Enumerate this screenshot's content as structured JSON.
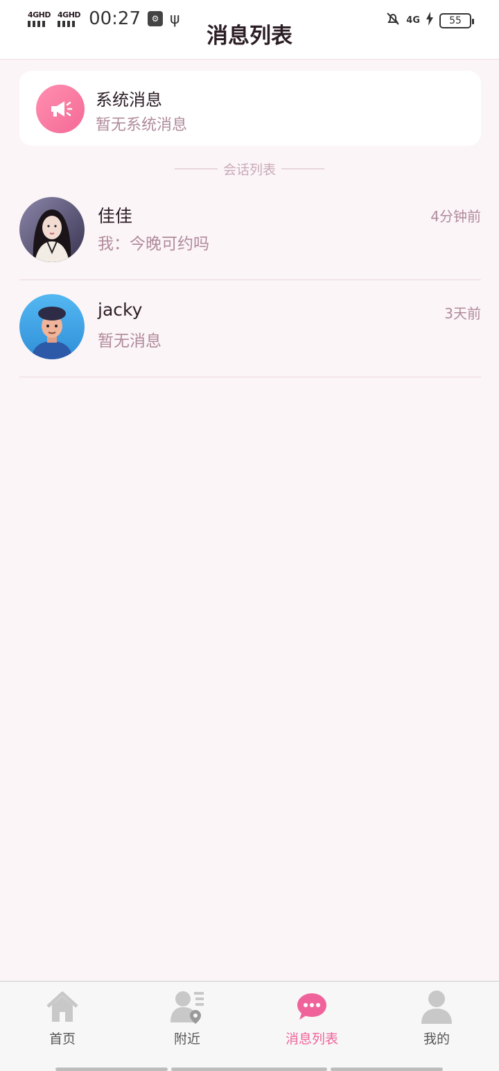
{
  "status_bar": {
    "network1": "4GHD",
    "network2": "4GHD",
    "time": "00:27",
    "network3": "4G",
    "battery": "55"
  },
  "header": {
    "title": "消息列表"
  },
  "system_card": {
    "title": "系统消息",
    "subtitle": "暂无系统消息"
  },
  "divider_label": "会话列表",
  "conversations": [
    {
      "name": "佳佳",
      "time": "4分钟前",
      "message": "我：今晚可约吗"
    },
    {
      "name": "jacky",
      "time": "3天前",
      "message": "暂无消息"
    }
  ],
  "tabs": [
    {
      "label": "首页",
      "icon": "home-icon"
    },
    {
      "label": "附近",
      "icon": "nearby-icon"
    },
    {
      "label": "消息列表",
      "icon": "chat-bubble-icon",
      "active": true
    },
    {
      "label": "我的",
      "icon": "profile-icon"
    }
  ],
  "colors": {
    "accent": "#f0639a",
    "muted_text": "#b08a9b",
    "background": "#fbf5f7"
  }
}
